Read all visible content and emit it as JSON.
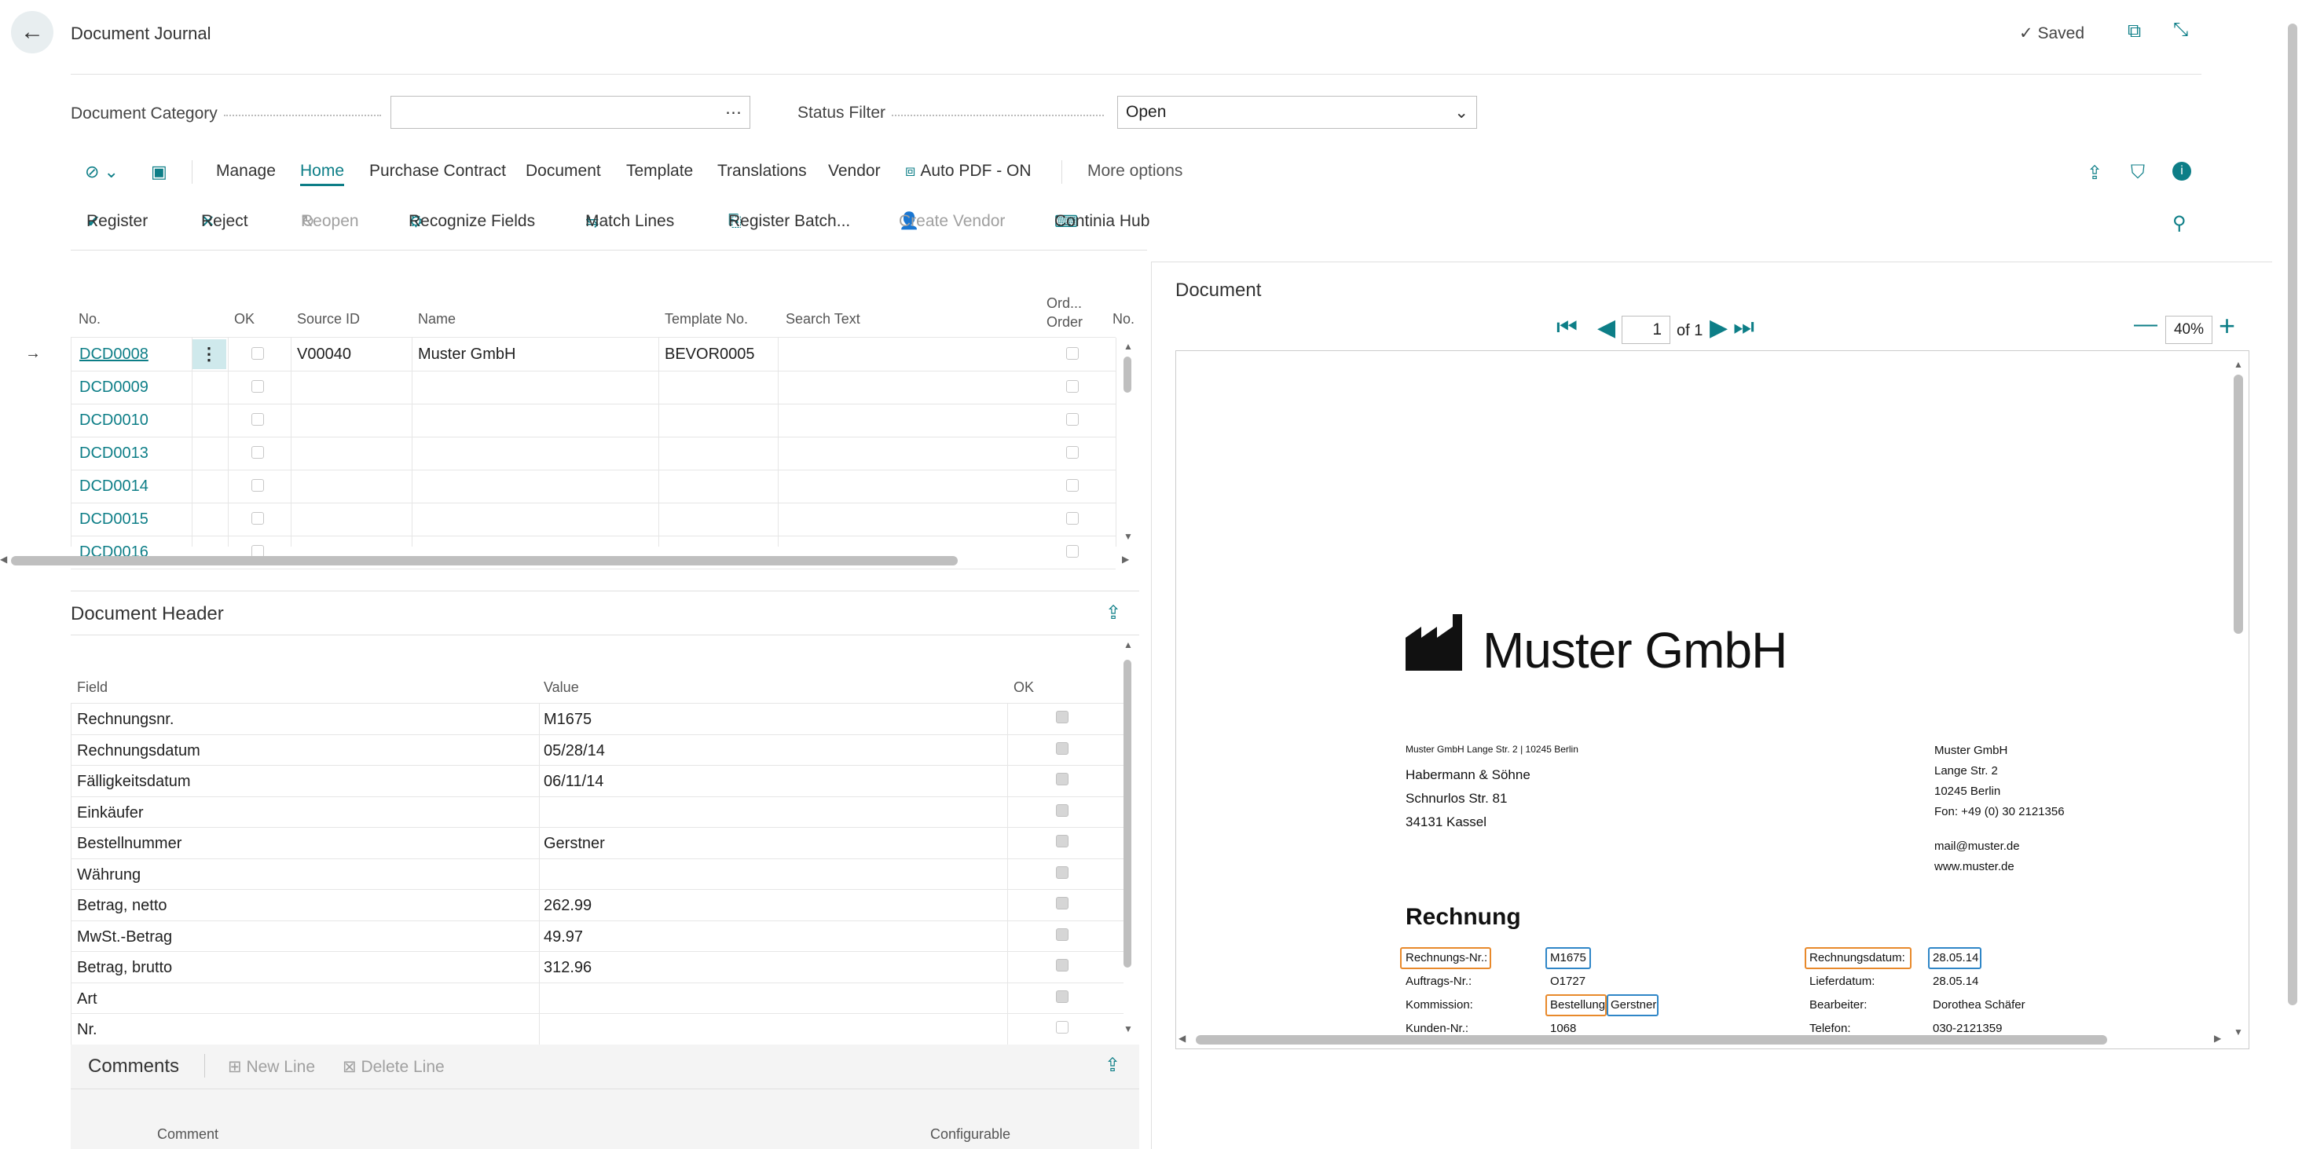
{
  "header": {
    "title": "Document Journal",
    "saved": "Saved"
  },
  "filters": {
    "category_label": "Document Category",
    "category_value": "",
    "status_label": "Status Filter",
    "status_value": "Open"
  },
  "nav": {
    "items": [
      "Manage",
      "Home",
      "Purchase Contract",
      "Document",
      "Template",
      "Translations",
      "Vendor",
      "Auto PDF - ON",
      "More options"
    ],
    "active": "Home"
  },
  "actions": {
    "register": "Register",
    "reject": "Reject",
    "reopen": "Reopen",
    "recognize": "Recognize Fields",
    "match": "Match Lines",
    "batch": "Register Batch...",
    "create_vendor": "Create Vendor",
    "hub": "Continia Hub"
  },
  "grid": {
    "columns": [
      "No.",
      "OK",
      "Source ID",
      "Name",
      "Template No.",
      "Search Text",
      "Ord... Order",
      "No."
    ],
    "rows": [
      {
        "no": "DCD0008",
        "source": "V00040",
        "name": "Muster GmbH",
        "template": "BEVOR0005"
      },
      {
        "no": "DCD0009",
        "source": "",
        "name": "",
        "template": ""
      },
      {
        "no": "DCD0010",
        "source": "",
        "name": "",
        "template": ""
      },
      {
        "no": "DCD0013",
        "source": "",
        "name": "",
        "template": ""
      },
      {
        "no": "DCD0014",
        "source": "",
        "name": "",
        "template": ""
      },
      {
        "no": "DCD0015",
        "source": "",
        "name": "",
        "template": ""
      },
      {
        "no": "DCD0016",
        "source": "",
        "name": "",
        "template": ""
      }
    ]
  },
  "doc_header": {
    "title": "Document Header",
    "columns": [
      "Field",
      "Value",
      "OK"
    ],
    "rows": [
      {
        "field": "Rechnungsnr.",
        "value": "M1675",
        "ok": true
      },
      {
        "field": "Rechnungsdatum",
        "value": "05/28/14",
        "ok": true
      },
      {
        "field": "Fälligkeitsdatum",
        "value": "06/11/14",
        "ok": true
      },
      {
        "field": "Einkäufer",
        "value": "",
        "ok": true
      },
      {
        "field": "Bestellnummer",
        "value": "Gerstner",
        "ok": true
      },
      {
        "field": "Währung",
        "value": "",
        "ok": true
      },
      {
        "field": "Betrag, netto",
        "value": "262.99",
        "ok": true
      },
      {
        "field": "MwSt.-Betrag",
        "value": "49.97",
        "ok": true
      },
      {
        "field": "Betrag, brutto",
        "value": "312.96",
        "ok": true
      },
      {
        "field": "Art",
        "value": "",
        "ok": true
      },
      {
        "field": "Nr.",
        "value": "",
        "ok": false
      }
    ]
  },
  "comments": {
    "title": "Comments",
    "new_line": "New Line",
    "delete_line": "Delete Line",
    "col_comment": "Comment",
    "col_config": "Configurable"
  },
  "preview": {
    "title": "Document",
    "page": "1",
    "of": "of 1",
    "zoom": "40%",
    "company": "Muster GmbH",
    "sender_line": "Muster GmbH Lange Str. 2 | 10245 Berlin",
    "recipient": [
      "Habermann & Söhne",
      "Schnurlos Str. 81",
      "34131 Kassel"
    ],
    "company_addr": [
      "Muster GmbH",
      "Lange Str. 2",
      "10245 Berlin",
      "Fon: +49 (0) 30 2121356"
    ],
    "contact": [
      "mail@muster.de",
      "www.muster.de"
    ],
    "heading": "Rechnung",
    "fields": {
      "rn_label": "Rechnungs-Nr.:",
      "rn_value": "M1675",
      "auftrag_label": "Auftrags-Nr.:",
      "auftrag_value": "O1727",
      "kommission_label": "Kommission:",
      "kommission_value1": "Bestellung",
      "kommission_value2": "Gerstner",
      "kunden_label": "Kunden-Nr.:",
      "kunden_value": "1068",
      "rd_label": "Rechnungsdatum:",
      "rd_value": "28.05.14",
      "liefer_label": "Lieferdatum:",
      "liefer_value": "28.05.14",
      "bearb_label": "Bearbeiter:",
      "bearb_value": "Dorothea Schäfer",
      "tel_label": "Telefon:",
      "tel_value": "030-2121359"
    }
  },
  "colors": {
    "accent": "#0d7e87",
    "orange": "#e8892b",
    "blue": "#2f86c7"
  }
}
